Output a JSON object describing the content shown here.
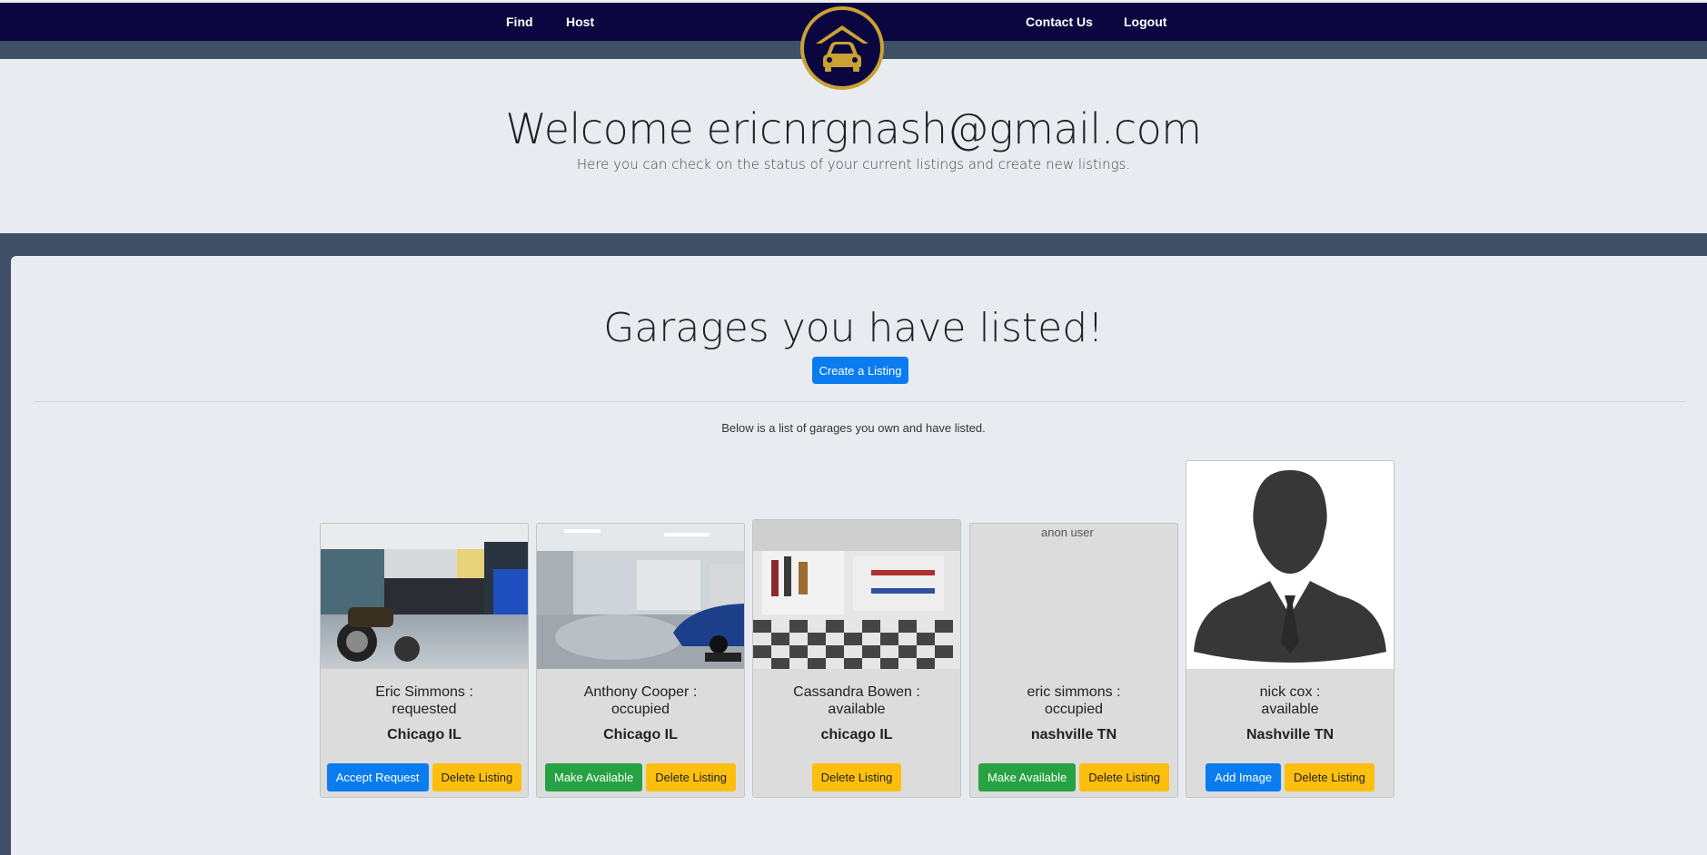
{
  "nav": {
    "find": "Find",
    "host": "Host",
    "contact": "Contact Us",
    "logout": "Logout"
  },
  "hero": {
    "welcome": "Welcome ericnrgnash@gmail.com",
    "subtitle": "Here you can check on the status of your current listings and create new listings."
  },
  "listings": {
    "title": "Garages you have listed!",
    "create_label": "Create a Listing",
    "description": "Below is a list of garages you own and have listed."
  },
  "cards": [
    {
      "name": "Eric Simmons :",
      "status": "requested",
      "city": "Chicago IL",
      "btn1": "Accept Request",
      "btn2": "Delete Listing"
    },
    {
      "name": "Anthony Cooper :",
      "status": "occupied",
      "city": "Chicago IL",
      "btn1": "Make Available",
      "btn2": "Delete Listing"
    },
    {
      "name": "Cassandra Bowen :",
      "status": "available",
      "city": "chicago IL",
      "btn2": "Delete Listing"
    },
    {
      "name": "eric simmons :",
      "status": "occupied",
      "city": "nashville TN",
      "btn1": "Make Available",
      "btn2": "Delete Listing",
      "alt": "anon user"
    },
    {
      "name": "nick cox :",
      "status": "available",
      "city": "Nashville TN",
      "btn1": "Add Image",
      "btn2": "Delete Listing"
    }
  ],
  "colors": {
    "navbar": "#0b0640",
    "logo_ring": "#c9a233",
    "primary": "#0a7cf0",
    "success": "#27a243",
    "warning": "#fdbf0e",
    "background": "#3f4f66",
    "panel": "#e8ecf0"
  },
  "icons": {
    "logo": "garage-car-icon"
  }
}
